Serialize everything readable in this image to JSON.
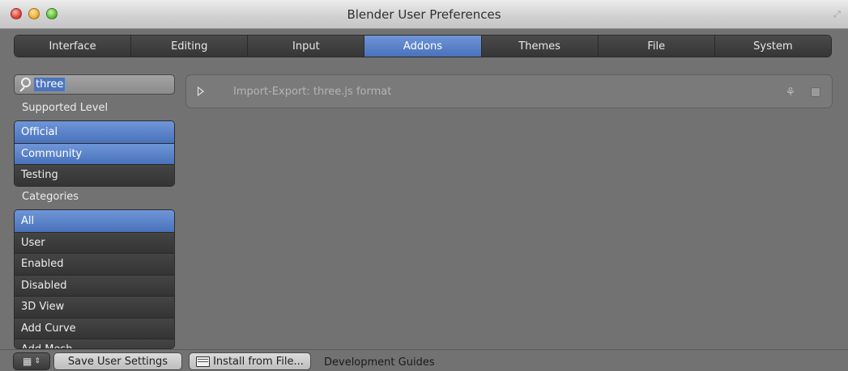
{
  "window": {
    "title": "Blender User Preferences"
  },
  "tabs": [
    {
      "label": "Interface",
      "active": false
    },
    {
      "label": "Editing",
      "active": false
    },
    {
      "label": "Input",
      "active": false
    },
    {
      "label": "Addons",
      "active": true
    },
    {
      "label": "Themes",
      "active": false
    },
    {
      "label": "File",
      "active": false
    },
    {
      "label": "System",
      "active": false
    }
  ],
  "search": {
    "value": "three"
  },
  "supported_level": {
    "label": "Supported Level",
    "items": [
      {
        "label": "Official",
        "active": true
      },
      {
        "label": "Community",
        "active": true
      },
      {
        "label": "Testing",
        "active": false
      }
    ]
  },
  "categories": {
    "label": "Categories",
    "items": [
      {
        "label": "All",
        "active": true
      },
      {
        "label": "User",
        "active": false
      },
      {
        "label": "Enabled",
        "active": false
      },
      {
        "label": "Disabled",
        "active": false
      },
      {
        "label": "3D View",
        "active": false
      },
      {
        "label": "Add Curve",
        "active": false
      },
      {
        "label": "Add Mesh",
        "active": false
      }
    ]
  },
  "addon": {
    "name": "Import-Export: three.js format",
    "user_icon": "user-addon-icon",
    "enabled": false
  },
  "bottom": {
    "editor_type_icon": "preferences-icon",
    "save_label": "Save User Settings",
    "install_label": "Install from File...",
    "dev_label": "Development Guides"
  },
  "colors": {
    "accent": "#5b82c8",
    "background": "#727272",
    "tab_bg": "#3e3e3e"
  }
}
